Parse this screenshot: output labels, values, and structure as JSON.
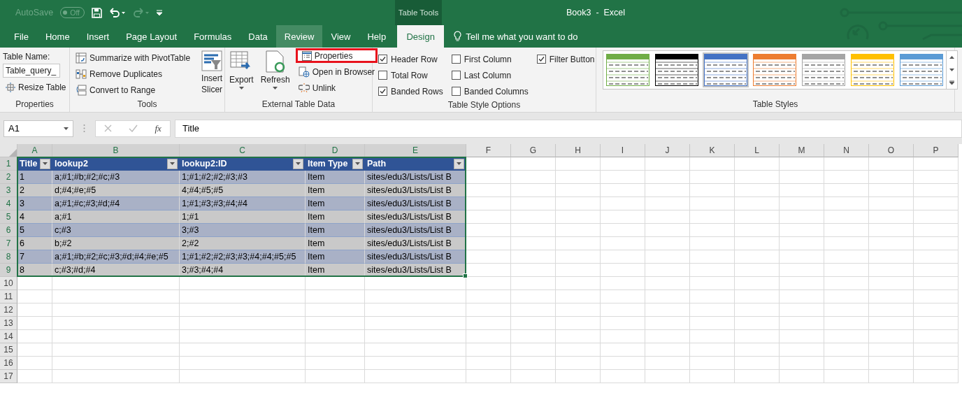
{
  "title_bar": {
    "autosave_label": "AutoSave",
    "autosave_toggle": {
      "label": "Off",
      "on": false
    },
    "context_label": "Table Tools",
    "title": "Book3  -  Excel"
  },
  "ribbon_tabs": [
    {
      "label": "File",
      "selected": false,
      "hovered": false
    },
    {
      "label": "Home",
      "selected": false,
      "hovered": false
    },
    {
      "label": "Insert",
      "selected": false,
      "hovered": false
    },
    {
      "label": "Page Layout",
      "selected": false,
      "hovered": false
    },
    {
      "label": "Formulas",
      "selected": false,
      "hovered": false
    },
    {
      "label": "Data",
      "selected": false,
      "hovered": false
    },
    {
      "label": "Review",
      "selected": false,
      "hovered": true
    },
    {
      "label": "View",
      "selected": false,
      "hovered": false
    },
    {
      "label": "Help",
      "selected": false,
      "hovered": false
    },
    {
      "label": "Design",
      "selected": true,
      "hovered": false
    }
  ],
  "tell_me": {
    "placeholder": "Tell me what you want to do"
  },
  "properties_group": {
    "label": "Properties",
    "table_name_label": "Table Name:",
    "table_name_value": "Table_query_",
    "resize_button": "Resize Table"
  },
  "tools_group": {
    "label": "Tools",
    "buttons": [
      "Summarize with PivotTable",
      "Remove Duplicates",
      "Convert to Range"
    ],
    "slicer_button": "Insert Slicer"
  },
  "external_group": {
    "label": "External Table Data",
    "export_button": "Export",
    "refresh_button": "Refresh",
    "buttons": [
      {
        "label": "Properties",
        "highlighted": true
      },
      {
        "label": "Open in Browser",
        "highlighted": false
      },
      {
        "label": "Unlink",
        "highlighted": false
      }
    ]
  },
  "style_options_group": {
    "label": "Table Style Options",
    "options": [
      {
        "label": "Header Row",
        "checked": true
      },
      {
        "label": "Total Row",
        "checked": false
      },
      {
        "label": "Banded Rows",
        "checked": true
      },
      {
        "label": "First Column",
        "checked": false
      },
      {
        "label": "Last Column",
        "checked": false
      },
      {
        "label": "Banded Columns",
        "checked": false
      },
      {
        "label": "Filter Button",
        "checked": true
      }
    ]
  },
  "table_styles_group": {
    "label": "Table Styles",
    "styles": [
      {
        "color": "#70ad47",
        "selected": false
      },
      {
        "color": "#000000",
        "selected": false
      },
      {
        "color": "#4472c4",
        "selected": true
      },
      {
        "color": "#ed7d31",
        "selected": false
      },
      {
        "color": "#a5a5a5",
        "selected": false
      },
      {
        "color": "#ffc000",
        "selected": false
      },
      {
        "color": "#5b9bd5",
        "selected": false
      }
    ]
  },
  "formula_bar": {
    "name_box": "A1",
    "function_label": "fx",
    "formula": "Title"
  },
  "sheet": {
    "columns": [
      "A",
      "B",
      "C",
      "D",
      "E",
      "F",
      "G",
      "H",
      "I",
      "J",
      "K",
      "L",
      "M",
      "N",
      "O",
      "P"
    ],
    "row_numbers": [
      "1",
      "2",
      "3",
      "4",
      "5",
      "6",
      "7",
      "8",
      "9",
      "10",
      "11",
      "12",
      "13",
      "14",
      "15",
      "16",
      "17"
    ],
    "table": {
      "headers": [
        "Title",
        "lookup2",
        "lookup2:ID",
        "Item Type",
        "Path"
      ],
      "rows": [
        [
          "1",
          "a;#1;#b;#2;#c;#3",
          "1;#1;#2;#2;#3;#3",
          "Item",
          "sites/edu3/Lists/List B"
        ],
        [
          "2",
          "d;#4;#e;#5",
          "4;#4;#5;#5",
          "Item",
          "sites/edu3/Lists/List B"
        ],
        [
          "3",
          "a;#1;#c;#3;#d;#4",
          "1;#1;#3;#3;#4;#4",
          "Item",
          "sites/edu3/Lists/List B"
        ],
        [
          "4",
          "a;#1",
          "1;#1",
          "Item",
          "sites/edu3/Lists/List B"
        ],
        [
          "5",
          "c;#3",
          "3;#3",
          "Item",
          "sites/edu3/Lists/List B"
        ],
        [
          "6",
          "b;#2",
          "2;#2",
          "Item",
          "sites/edu3/Lists/List B"
        ],
        [
          "7",
          "a;#1;#b;#2;#c;#3;#d;#4;#e;#5",
          "1;#1;#2;#2;#3;#3;#4;#4;#5;#5",
          "Item",
          "sites/edu3/Lists/List B"
        ],
        [
          "8",
          "c;#3;#d;#4",
          "3;#3;#4;#4",
          "Item",
          "sites/edu3/Lists/List B"
        ]
      ]
    }
  }
}
